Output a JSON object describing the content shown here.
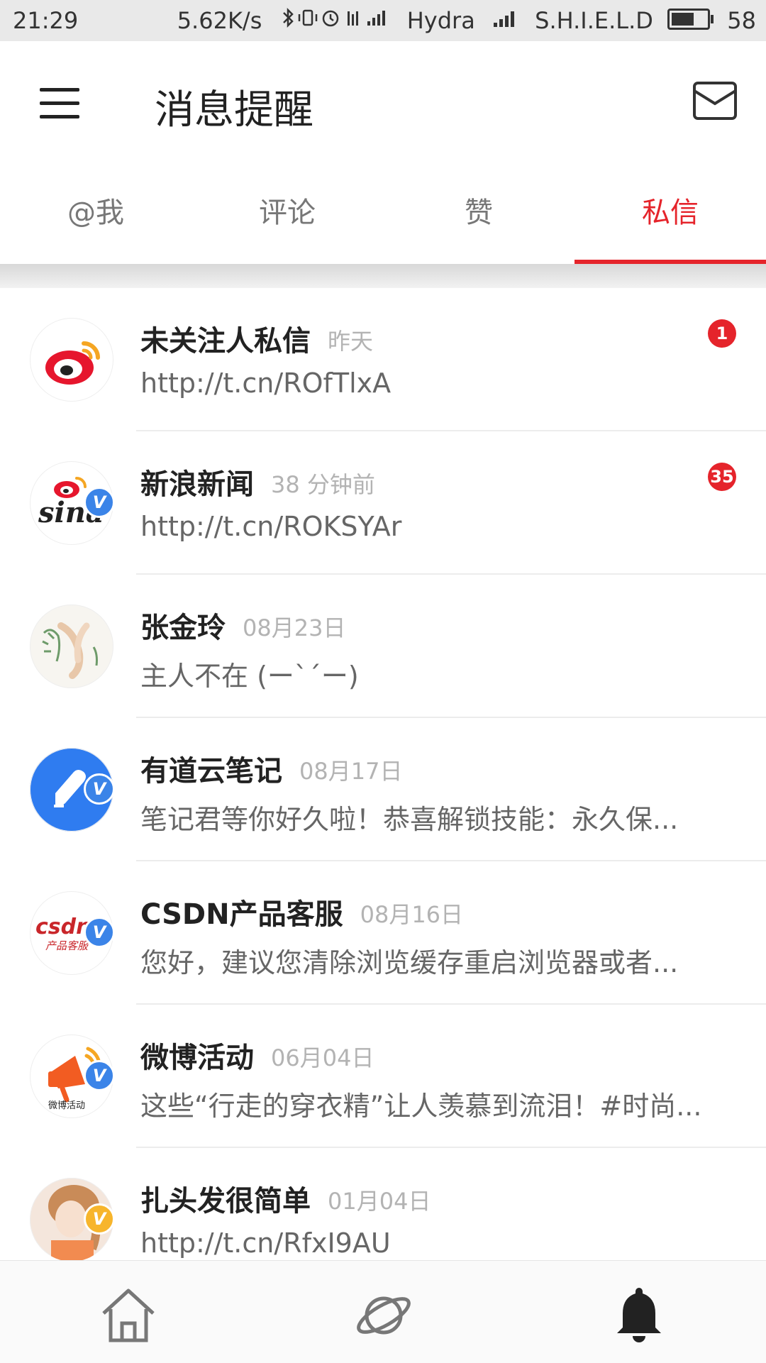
{
  "status_bar": {
    "time": "21:29",
    "network_speed": "5.62K/s",
    "carrier1": "Hydra",
    "carrier2": "S.H.I.E.L.D",
    "battery": "58"
  },
  "header": {
    "title": "消息提醒",
    "menu_icon": "hamburger-menu-icon",
    "mail_icon": "mail-icon"
  },
  "tabs": [
    {
      "label": "@我"
    },
    {
      "label": "评论"
    },
    {
      "label": "赞"
    },
    {
      "label": "私信"
    }
  ],
  "active_tab_index": 3,
  "accent_color": "#e5242b",
  "conversations": [
    {
      "name": "未关注人私信",
      "time": "昨天",
      "preview": "http://t.cn/ROfTlxA",
      "unread": "1",
      "verified": false
    },
    {
      "name": "新浪新闻",
      "time": "38 分钟前",
      "preview": "http://t.cn/ROKSYAr",
      "unread": "35",
      "verified": true
    },
    {
      "name": "张金玲",
      "time": "08月23日",
      "preview": "主人不在 (ー`´ー)",
      "unread": "",
      "verified": false
    },
    {
      "name": "有道云笔记",
      "time": "08月17日",
      "preview": "笔记君等你好久啦！恭喜解锁技能：永久保...",
      "unread": "",
      "verified": true
    },
    {
      "name": "CSDN产品客服",
      "time": "08月16日",
      "preview": "您好，建议您清除浏览缓存重启浏览器或者...",
      "unread": "",
      "verified": true
    },
    {
      "name": "微博活动",
      "time": "06月04日",
      "preview": "这些“行走的穿衣精”让人羡慕到流泪！#时尚...",
      "unread": "",
      "verified": true
    },
    {
      "name": "扎头发很简单",
      "time": "01月04日",
      "preview": "http://t.cn/RfxI9AU",
      "unread": "",
      "verified": true
    }
  ],
  "avatar_text": {
    "sina": "sina",
    "csdn": "csdn",
    "csdn_sub": "产品客服",
    "weibo_activity": "微博活动"
  },
  "verified_badge": "V",
  "bottom_nav": [
    {
      "icon": "home-icon"
    },
    {
      "icon": "discover-planet-icon"
    },
    {
      "icon": "notification-bell-icon"
    }
  ]
}
